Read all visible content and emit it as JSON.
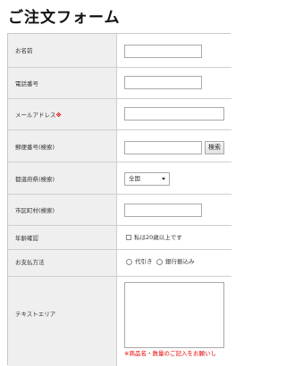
{
  "page": {
    "title": "ご注文フォーム"
  },
  "form": {
    "name_label": "お名前",
    "phone_label": "電話番号",
    "email_label": "メールアドレス",
    "required_mark": "※",
    "postal_label": "郵便番号(検索)",
    "search_button": "検索",
    "prefecture_label": "都道府県(検索)",
    "prefecture_value": "全国",
    "city_label": "市区町村(検索)",
    "age_label": "年齢確認",
    "age_checkbox_label": "私は20歳以上です",
    "payment_label": "お支払方法",
    "payment_options": [
      "代引き",
      "銀行振込み"
    ],
    "textarea_label": "テキストエリア",
    "textarea_note": "※商品名・数量のご記入をお願いし"
  },
  "colors": {
    "required": "#e60000",
    "label_bg": "#efefef",
    "border": "#cfcfcf"
  }
}
